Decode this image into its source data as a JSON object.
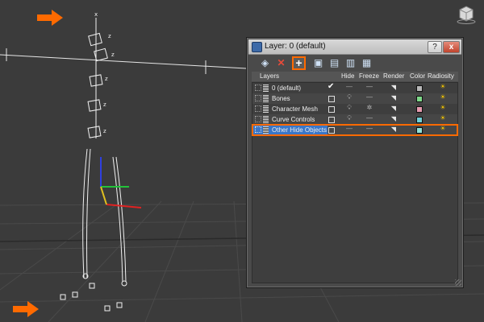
{
  "dialog": {
    "title": "Layer: 0 (default)",
    "help_label": "?",
    "close_label": "x"
  },
  "toolbar": {
    "add_label": "+",
    "delete_label": "✕"
  },
  "columns": [
    "Layers",
    "Hide",
    "Freeze",
    "Render",
    "Color",
    "Radiosity"
  ],
  "layers": [
    {
      "name": "0 (default)",
      "active": true,
      "color": "#b9b9b9"
    },
    {
      "name": "Bones",
      "active": false,
      "color": "#7fd98a"
    },
    {
      "name": "Character Mesh",
      "active": false,
      "color": "#e79ab0"
    },
    {
      "name": "Curve Controls",
      "active": false,
      "color": "#6fd0d6"
    },
    {
      "name": "Other Hide Objects",
      "active": false,
      "color": "#8fe0d8",
      "selected": true
    }
  ],
  "colors": {
    "annotation": "#ff6a00",
    "selection": "#3a76c8",
    "viewport_bg": "#3b3b3b"
  },
  "icons": {
    "hide": "dash-icon",
    "freeze": "snowflake-icon",
    "render": "teapot-icon",
    "radiosity": "lamp-icon"
  }
}
